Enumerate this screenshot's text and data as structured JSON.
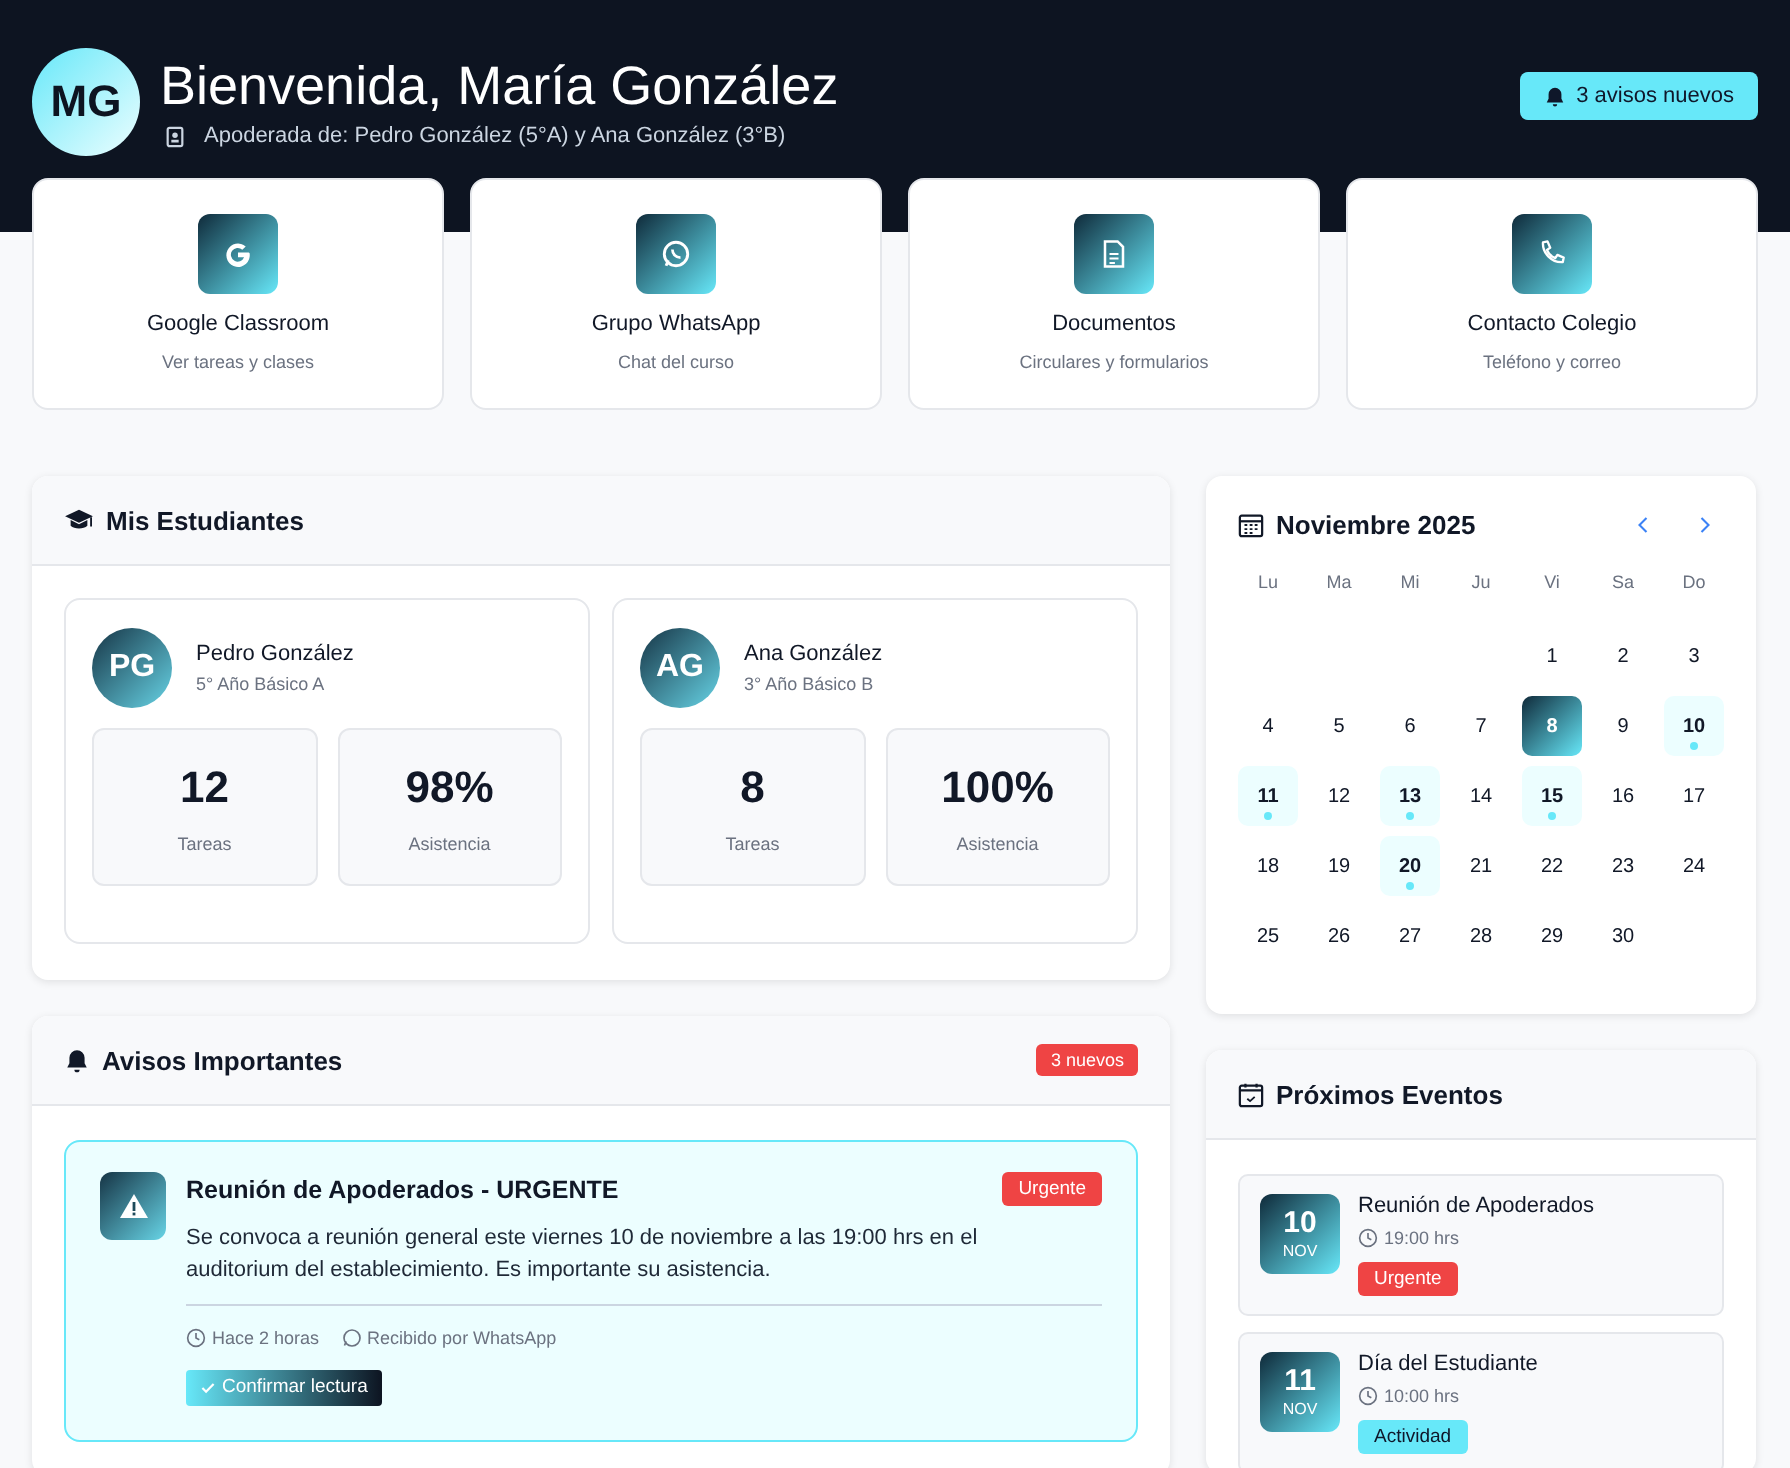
{
  "header": {
    "avatar": "MG",
    "title": "Bienvenida, María González",
    "subtitle": "Apoderada de: Pedro González (5°A) y Ana González (3°B)",
    "notice_button": "3 avisos nuevos"
  },
  "quick_links": [
    {
      "kind": "google",
      "title": "Google Classroom",
      "subtitle": "Ver tareas y clases"
    },
    {
      "kind": "whatsapp",
      "title": "Grupo WhatsApp",
      "subtitle": "Chat del curso"
    },
    {
      "kind": "document",
      "title": "Documentos",
      "subtitle": "Circulares y formularios"
    },
    {
      "kind": "phone",
      "title": "Contacto Colegio",
      "subtitle": "Teléfono y correo"
    }
  ],
  "students_panel": {
    "title": "Mis Estudiantes",
    "students": [
      {
        "initials": "PG",
        "name": "Pedro González",
        "grade": "5° Año Básico A",
        "stats": [
          {
            "value": "12",
            "label": "Tareas"
          },
          {
            "value": "98%",
            "label": "Asistencia"
          }
        ]
      },
      {
        "initials": "AG",
        "name": "Ana González",
        "grade": "3° Año Básico B",
        "stats": [
          {
            "value": "8",
            "label": "Tareas"
          },
          {
            "value": "100%",
            "label": "Asistencia"
          }
        ]
      }
    ]
  },
  "notices_panel": {
    "title": "Avisos Importantes",
    "badge": "3 nuevos",
    "notices": [
      {
        "title": "Reunión de Apoderados - URGENTE",
        "tag": "Urgente",
        "text": "Se convoca a reunión general este viernes 10 de noviembre a las 19:00 hrs en el auditorium del establecimiento. Es importante su asistencia.",
        "time": "Hace 2 horas",
        "source": "Recibido por WhatsApp",
        "action": "Confirmar lectura"
      }
    ]
  },
  "calendar": {
    "title": "Noviembre 2025",
    "weekdays": [
      "Lu",
      "Ma",
      "Mi",
      "Ju",
      "Vi",
      "Sa",
      "Do"
    ],
    "days": [
      {
        "kind": "blank"
      },
      {
        "kind": "blank"
      },
      {
        "kind": "blank"
      },
      {
        "kind": "blank"
      },
      {
        "kind": "day",
        "label": "1",
        "selected": false,
        "has_event": false
      },
      {
        "kind": "day",
        "label": "2",
        "selected": false,
        "has_event": false
      },
      {
        "kind": "day",
        "label": "3",
        "selected": false,
        "has_event": false
      },
      {
        "kind": "day",
        "label": "4",
        "selected": false,
        "has_event": false
      },
      {
        "kind": "day",
        "label": "5",
        "selected": false,
        "has_event": false
      },
      {
        "kind": "day",
        "label": "6",
        "selected": false,
        "has_event": false
      },
      {
        "kind": "day",
        "label": "7",
        "selected": false,
        "has_event": false
      },
      {
        "kind": "day",
        "label": "8",
        "selected": true,
        "has_event": false
      },
      {
        "kind": "day",
        "label": "9",
        "selected": false,
        "has_event": false
      },
      {
        "kind": "day",
        "label": "10",
        "selected": false,
        "has_event": true
      },
      {
        "kind": "day",
        "label": "11",
        "selected": false,
        "has_event": true
      },
      {
        "kind": "day",
        "label": "12",
        "selected": false,
        "has_event": false
      },
      {
        "kind": "day",
        "label": "13",
        "selected": false,
        "has_event": true
      },
      {
        "kind": "day",
        "label": "14",
        "selected": false,
        "has_event": false
      },
      {
        "kind": "day",
        "label": "15",
        "selected": false,
        "has_event": true
      },
      {
        "kind": "day",
        "label": "16",
        "selected": false,
        "has_event": false
      },
      {
        "kind": "day",
        "label": "17",
        "selected": false,
        "has_event": false
      },
      {
        "kind": "day",
        "label": "18",
        "selected": false,
        "has_event": false
      },
      {
        "kind": "day",
        "label": "19",
        "selected": false,
        "has_event": false
      },
      {
        "kind": "day",
        "label": "20",
        "selected": false,
        "has_event": true
      },
      {
        "kind": "day",
        "label": "21",
        "selected": false,
        "has_event": false
      },
      {
        "kind": "day",
        "label": "22",
        "selected": false,
        "has_event": false
      },
      {
        "kind": "day",
        "label": "23",
        "selected": false,
        "has_event": false
      },
      {
        "kind": "day",
        "label": "24",
        "selected": false,
        "has_event": false
      },
      {
        "kind": "day",
        "label": "25",
        "selected": false,
        "has_event": false
      },
      {
        "kind": "day",
        "label": "26",
        "selected": false,
        "has_event": false
      },
      {
        "kind": "day",
        "label": "27",
        "selected": false,
        "has_event": false
      },
      {
        "kind": "day",
        "label": "28",
        "selected": false,
        "has_event": false
      },
      {
        "kind": "day",
        "label": "29",
        "selected": false,
        "has_event": false
      },
      {
        "kind": "day",
        "label": "30",
        "selected": false,
        "has_event": false
      }
    ]
  },
  "events_panel": {
    "title": "Próximos Eventos",
    "events": [
      {
        "day": "10",
        "month": "NOV",
        "title": "Reunión de Apoderados",
        "time": "19:00 hrs",
        "tag": "Urgente",
        "kind": "urgent"
      },
      {
        "day": "11",
        "month": "NOV",
        "title": "Día del Estudiante",
        "time": "10:00 hrs",
        "tag": "Actividad",
        "kind": "activity"
      }
    ]
  }
}
